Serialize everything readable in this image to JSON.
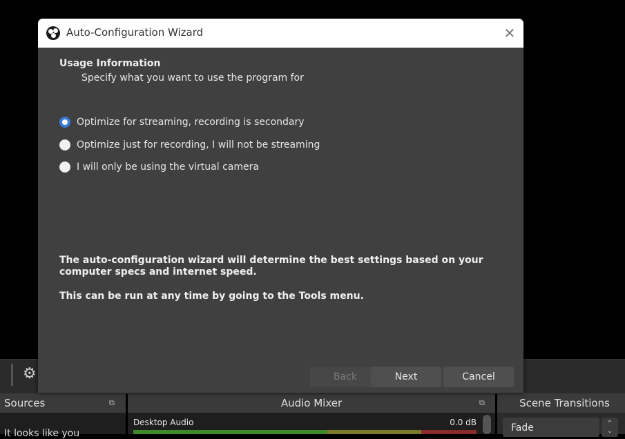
{
  "dialog": {
    "title": "Auto-Configuration Wizard",
    "close_symbol": "✕",
    "heading": "Usage Information",
    "subheading": "Specify what you want to use the program for",
    "options": [
      {
        "label": "Optimize for streaming, recording is secondary",
        "selected": true
      },
      {
        "label": "Optimize just for recording, I will not be streaming",
        "selected": false
      },
      {
        "label": "I will only be using the virtual camera",
        "selected": false
      }
    ],
    "info_line_1": "The auto-configuration wizard will determine the best settings based on your computer specs and internet speed.",
    "info_line_2": "This can be run at any time by going to the Tools menu.",
    "buttons": {
      "back": "Back",
      "next": "Next",
      "cancel": "Cancel"
    },
    "back_enabled": false
  },
  "background": {
    "sources_title": "Sources",
    "sources_hint": "It looks like you",
    "mixer_title": "Audio Mixer",
    "mixer_channel": "Desktop Audio",
    "mixer_db": "0.0 dB",
    "transitions_title": "Scene Transitions",
    "transition_selected": "Fade",
    "float_symbol": "⧉",
    "gear_symbol": "⚙",
    "spin_up": "⌃",
    "spin_down": "⌄"
  },
  "colors": {
    "dialog_bg": "#404040",
    "titlebar_bg": "#ffffff",
    "radio_checked": "#3a7ad8",
    "meter_green": "#3b8a2e",
    "meter_yellow": "#7b7a28",
    "meter_red": "#8a2a2a"
  }
}
